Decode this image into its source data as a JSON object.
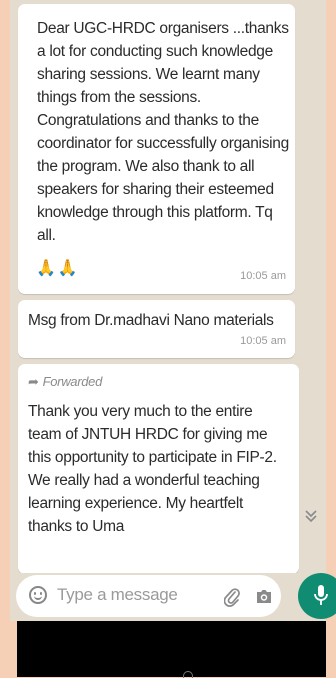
{
  "messages": [
    {
      "text": "Dear UGC-HRDC organisers ...thanks a lot for conducting such knowledge sharing sessions. We learnt many things from the sessions. Congratulations and thanks to the coordinator for successfully organising the program. We also thank to all speakers for sharing their esteemed knowledge through this platform. Tq all.",
      "emoji": "🙏🙏",
      "time": "10:05 am"
    },
    {
      "text": "Msg from Dr.madhavi Nano materials",
      "time": "10:05 am"
    },
    {
      "forwarded_label": "Forwarded",
      "text": "Thank you very much to the entire team of JNTUH HRDC for giving me this opportunity to participate in FIP-2.  We really had a wonderful teaching learning experience. My heartfelt thanks to Uma"
    }
  ],
  "input": {
    "placeholder": "Type a message"
  },
  "icons": {
    "emoji": "smiley-icon",
    "attach": "paperclip-icon",
    "camera": "camera-icon",
    "mic": "mic-icon",
    "scroll": "double-chevron-down-icon",
    "forward": "forward-arrow-icon"
  },
  "colors": {
    "chat_bg": "#e3dccf",
    "bubble": "#ffffff",
    "accent": "#0f8c72",
    "page_bg": "#f6cfb7"
  }
}
